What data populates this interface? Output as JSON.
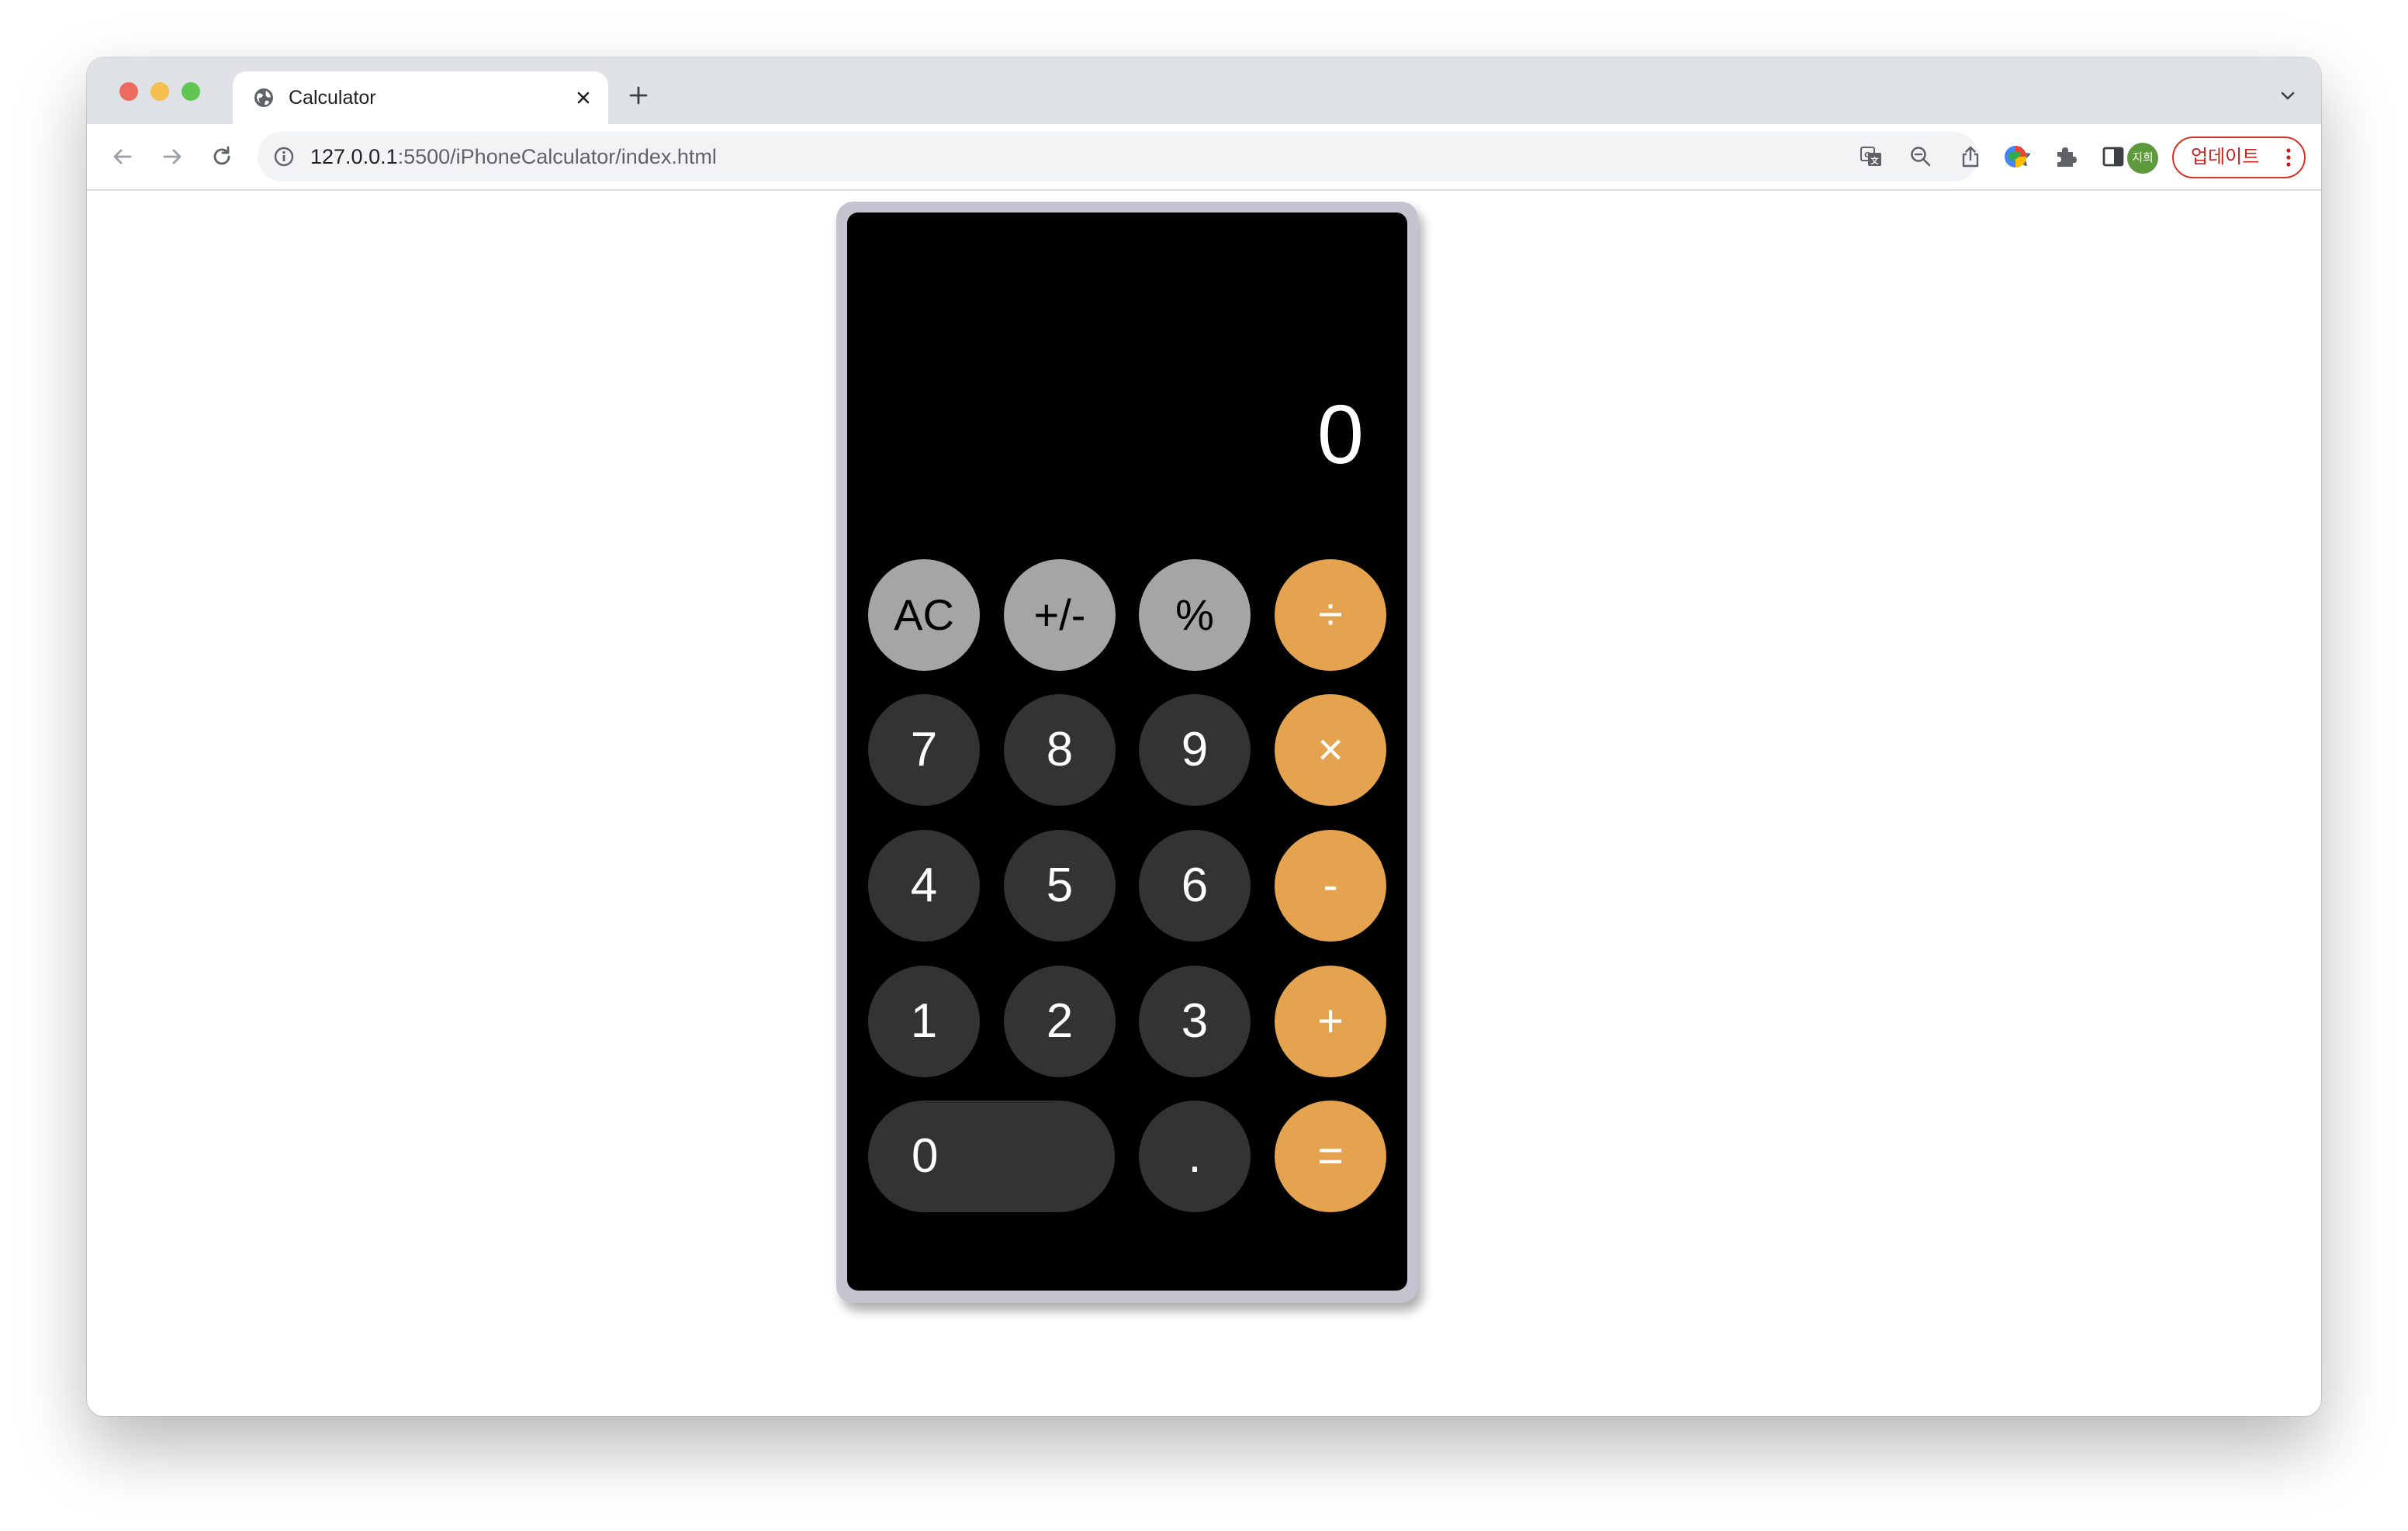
{
  "browser": {
    "tab_title": "Calculator",
    "url_host": "127.0.0.1",
    "url_rest": ":5500/iPhoneCalculator/index.html",
    "profile_initials": "지희",
    "update_label": "업데이트"
  },
  "calculator": {
    "display": "0",
    "keys": {
      "ac": "AC",
      "plus_minus": "+/-",
      "percent": "%",
      "divide": "÷",
      "seven": "7",
      "eight": "8",
      "nine": "9",
      "multiply": "×",
      "four": "4",
      "five": "5",
      "six": "6",
      "minus": "-",
      "one": "1",
      "two": "2",
      "three": "3",
      "plus": "+",
      "zero": "0",
      "decimal": ".",
      "equals": "="
    },
    "colors": {
      "function_key": "#a5a5a5",
      "digit_key": "#333333",
      "operator_key": "#e5a350",
      "screen": "#000000",
      "frame": "#c4c3cf"
    }
  }
}
